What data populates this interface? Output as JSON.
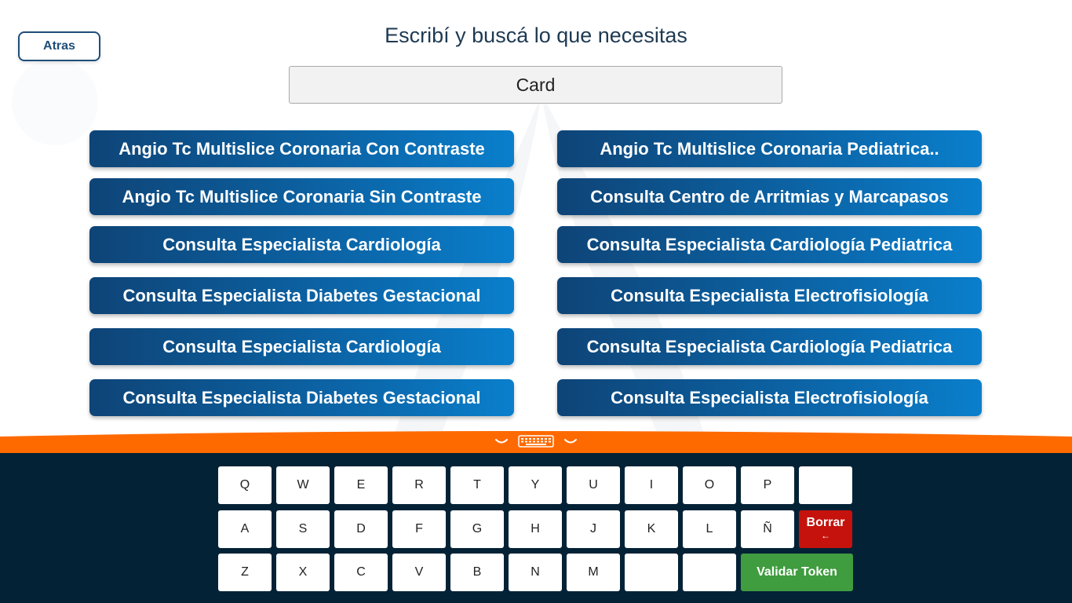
{
  "back_label": "Atras",
  "prompt": "Escribí y buscá lo que necesitas",
  "search": {
    "value": "Card"
  },
  "results": {
    "left": [
      "Angio Tc Multislice Coronaria Con Contraste",
      "Angio Tc Multislice Coronaria Sin Contraste",
      "Consulta Especialista Cardiología",
      "Consulta Especialista Diabetes Gestacional",
      "Consulta Especialista Cardiología",
      "Consulta Especialista Diabetes Gestacional"
    ],
    "right": [
      "Angio Tc Multislice Coronaria Pediatrica..",
      "Consulta Centro de Arritmias y Marcapasos",
      "Consulta Especialista Cardiología Pediatrica",
      "Consulta Especialista Electrofisiología",
      "Consulta Especialista Cardiología Pediatrica",
      "Consulta Especialista Electrofisiología"
    ]
  },
  "keyboard": {
    "row1": [
      "Q",
      "W",
      "E",
      "R",
      "T",
      "Y",
      "U",
      "I",
      "O",
      "P",
      ""
    ],
    "row2": [
      "A",
      "S",
      "D",
      "F",
      "G",
      "H",
      "J",
      "K",
      "L",
      "Ñ"
    ],
    "row3": [
      "Z",
      "X",
      "C",
      "V",
      "B",
      "N",
      "M",
      "",
      ""
    ],
    "delete_label": "Borrar",
    "delete_arrow": "←",
    "validate_label": "Validar Token"
  },
  "colors": {
    "accent_orange": "#ff6a00",
    "keyboard_bg": "#042236",
    "delete_red": "#c5120c",
    "validate_green": "#3f9c3f",
    "button_blue": "#0e4477"
  },
  "icons": {
    "toggle_left": "chevron-down-icon",
    "toggle_center": "keyboard-icon",
    "toggle_right": "chevron-down-icon"
  }
}
